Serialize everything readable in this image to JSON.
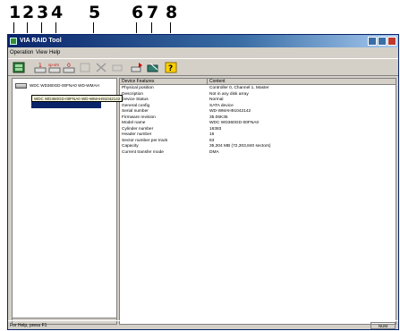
{
  "callouts": [
    "1",
    "2",
    "3",
    "4",
    "5",
    "6",
    "7",
    "8"
  ],
  "window": {
    "title": "VIA RAID Tool"
  },
  "menu": [
    "Operation",
    "View",
    "Help"
  ],
  "toolbar": {
    "buttons": [
      {
        "icon": "raid-array-icon"
      },
      {
        "icon": "create-array-icon",
        "badge": "1"
      },
      {
        "icon": "create-array-icon",
        "badge": "sp-sm"
      },
      {
        "icon": "create-array-icon",
        "badge": "0"
      },
      {
        "icon": "disabled-icon"
      },
      {
        "icon": "delete-array-icon"
      },
      {
        "icon": "disabled-icon"
      },
      {
        "icon": "duplicate-icon"
      },
      {
        "icon": "edit-icon"
      },
      {
        "icon": "help-icon",
        "badge": "?"
      }
    ]
  },
  "tree": {
    "items": [
      "WDC WD360GD-00FNA0 WD-WMAH"
    ],
    "tooltip": "WDC WD360GD-00FNA0 WD-WMAH91042142"
  },
  "details": {
    "headers": [
      "Device Features",
      "Content"
    ],
    "rows": [
      [
        "Physical position",
        "Controller 0, Channel 1, Master"
      ],
      [
        "Description",
        "Not in any disk array"
      ],
      [
        "Device Status",
        "Normal"
      ],
      [
        "General config",
        "SATA device"
      ],
      [
        "Serial number",
        "WD-WMAH91042142"
      ],
      [
        "Firmware revision",
        "35.06K35"
      ],
      [
        "Model name",
        "WDC WD360GD-00FNA0"
      ],
      [
        "Cylinder number",
        "16383"
      ],
      [
        "Header number",
        "16"
      ],
      [
        "Sector number per track",
        "63"
      ],
      [
        "Capacity",
        "35,304 MB (72,303,840 sectors)"
      ],
      [
        "Current transfer mode",
        "DMA"
      ]
    ]
  },
  "status": {
    "text": "For Help, press F1",
    "num": "NUM"
  }
}
